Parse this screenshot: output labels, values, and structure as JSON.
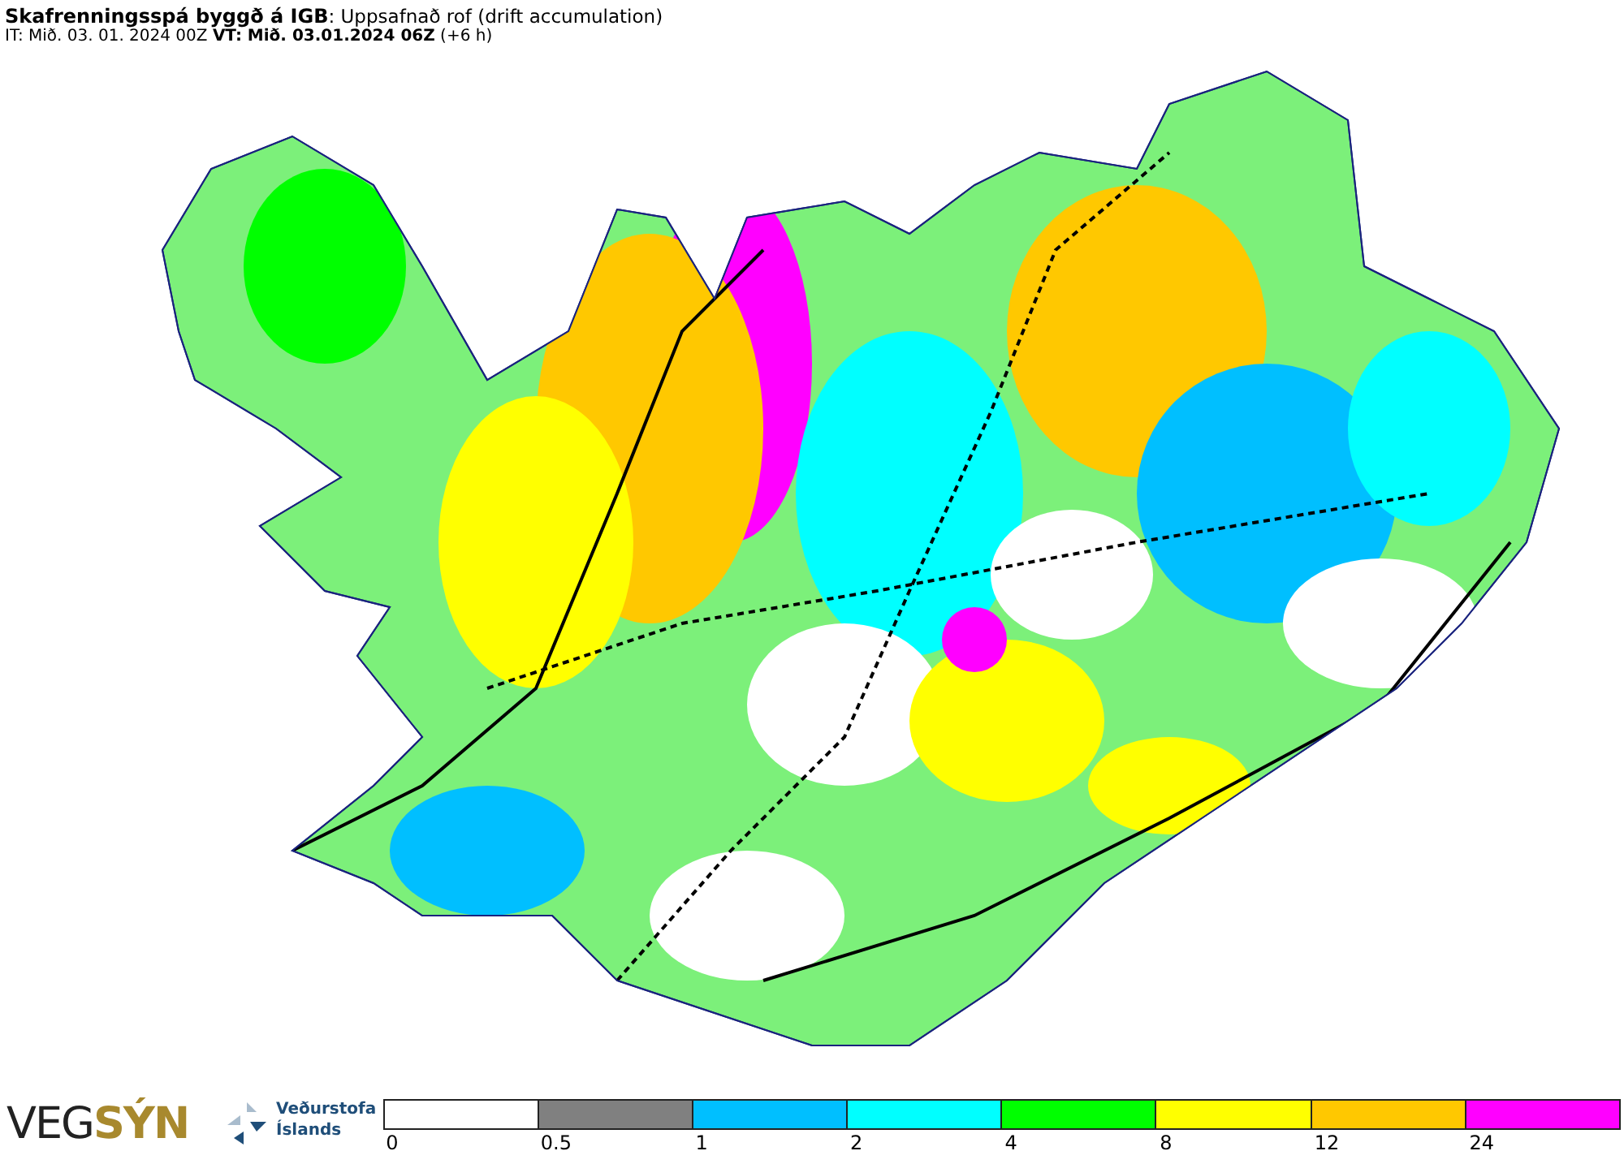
{
  "header": {
    "title": "**Skafrenningsspá byggð á IGB**: Uppsafnað rof (drift accumulation)",
    "subtitle": "IT: Mið. 03. 01. 2024 00Z **VT: Mið. 03.01.2024 06Z** (+6 h)"
  },
  "logos": {
    "vegsyn": "VEG**SÝN**",
    "met_office": [
      "Veðurstofa",
      "Íslands"
    ]
  },
  "legend": {
    "segments": [
      {
        "color": "#ffffff"
      },
      {
        "color": "#808080"
      },
      {
        "color": "#00bfff"
      },
      {
        "color": "#00ffff"
      },
      {
        "color": "#00ff00"
      },
      {
        "color": "#ffff00"
      },
      {
        "color": "#ffc800"
      },
      {
        "color": "#ff00ff"
      }
    ],
    "labels": [
      "0",
      "0.5",
      "1",
      "2",
      "4",
      "8",
      "12",
      "24"
    ]
  }
}
